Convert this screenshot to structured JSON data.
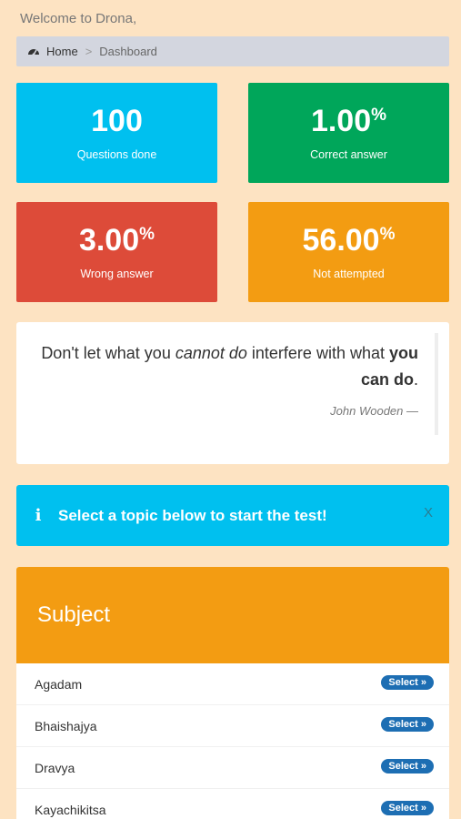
{
  "header": {
    "welcome": "Welcome to Drona,"
  },
  "breadcrumb": {
    "home": "Home",
    "separator": ">",
    "current": "Dashboard"
  },
  "stats": [
    {
      "value": "100",
      "suffix": "",
      "label": "Questions done",
      "color": "#00c0ef"
    },
    {
      "value": "1.00",
      "suffix": "%",
      "label": "Correct answer",
      "color": "#00a65a"
    },
    {
      "value": "3.00",
      "suffix": "%",
      "label": "Wrong answer",
      "color": "#dd4b39"
    },
    {
      "value": "56.00",
      "suffix": "%",
      "label": "Not attempted",
      "color": "#f39c12"
    }
  ],
  "quote": {
    "part1": "Don't let what you ",
    "em": "cannot do",
    "part2": " interfere with what ",
    "strong": "you can do",
    "end": ".",
    "author": "John Wooden —"
  },
  "alert": {
    "icon": "info-icon",
    "message": "Select a topic below to start the test!",
    "close": "X"
  },
  "subjects": {
    "title": "Subject",
    "select_label": "Select »",
    "items": [
      "Agadam",
      "Bhaishajya",
      "Dravya",
      "Kayachikitsa"
    ]
  }
}
